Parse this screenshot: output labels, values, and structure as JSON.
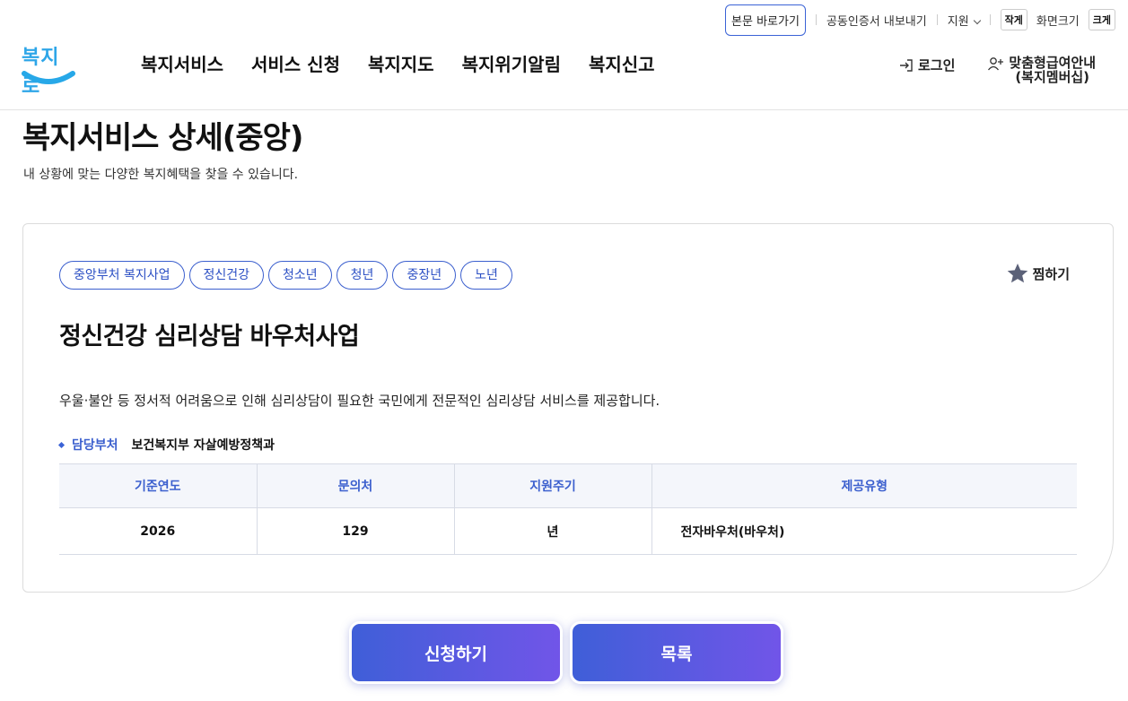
{
  "utility": {
    "skip_label": "본문 바로가기",
    "cert_export_label": "공동인증서 내보내기",
    "support_label": "지원",
    "font_small": "작게",
    "font_size_label": "화면크기",
    "font_large": "크게"
  },
  "header": {
    "logo_text": "복지로",
    "nav": [
      {
        "label": "복지서비스"
      },
      {
        "label": "서비스 신청"
      },
      {
        "label": "복지지도"
      },
      {
        "label": "복지위기알림"
      },
      {
        "label": "복지신고"
      }
    ],
    "login_label": "로그인",
    "member_label_line1": "맞춤형급여안내",
    "member_label_line2": "(복지멤버십)"
  },
  "page": {
    "title": "복지서비스 상세(중앙)",
    "description": "내 상황에 맞는 다양한 복지혜택을 찾을 수 있습니다."
  },
  "service": {
    "tags": [
      "중앙부처 복지사업",
      "정신건강",
      "청소년",
      "청년",
      "중장년",
      "노년"
    ],
    "favorite_label": "찜하기",
    "title": "정신건강 심리상담 바우처사업",
    "summary": "우울·불안 등 정서적 어려움으로 인해 심리상담이 필요한 국민에게 전문적인 심리상담 서비스를 제공합니다.",
    "department_label": "담당부처",
    "department_value": "보건복지부 자살예방정책과",
    "table": {
      "headers": [
        "기준연도",
        "문의처",
        "지원주기",
        "제공유형"
      ],
      "row": [
        "2026",
        "129",
        "년",
        "전자바우처(바우처)"
      ]
    }
  },
  "actions": {
    "apply_label": "신청하기",
    "list_label": "목록"
  },
  "colors": {
    "accent": "#3b5fce",
    "button_gradient_start": "#3f5fd8",
    "button_gradient_end": "#7155e8",
    "logo": "#2ea6e8"
  }
}
